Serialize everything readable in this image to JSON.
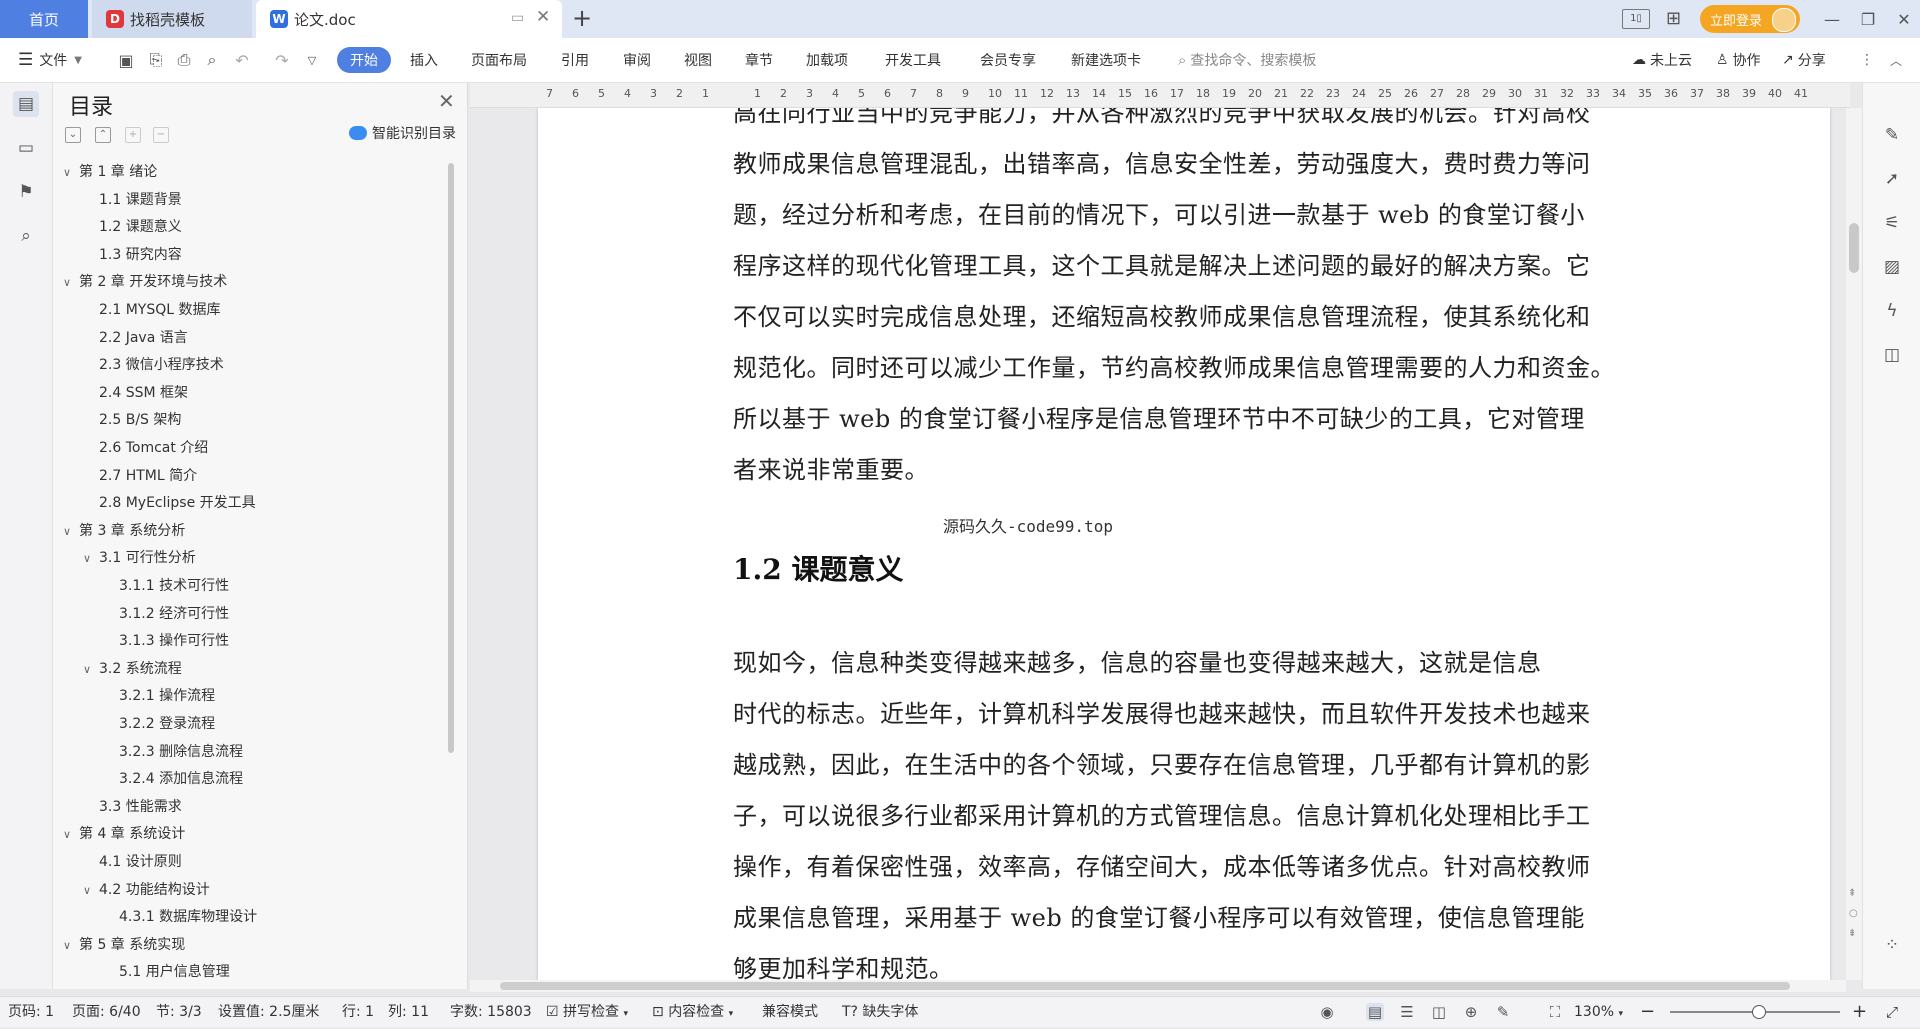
{
  "titlebar": {
    "tabs": [
      {
        "label": "首页"
      },
      {
        "label": "找稻壳模板"
      },
      {
        "label": "论文.doc"
      }
    ],
    "login_label": "立即登录"
  },
  "toolbar": {
    "file_label": "文件",
    "tabs": [
      "开始",
      "插入",
      "页面布局",
      "引用",
      "审阅",
      "视图",
      "章节",
      "加载项",
      "开发工具",
      "会员专享",
      "新建选项卡"
    ],
    "search_placeholder": "查找命令、搜索模板",
    "cloud_label": "未上云",
    "collab_label": "协作",
    "share_label": "分享"
  },
  "toc": {
    "title": "目录",
    "smart_label": "智能识别目录",
    "items": [
      {
        "label": "第 1 章  绪论",
        "level": 1,
        "caret": true
      },
      {
        "label": "1.1  课题背景",
        "level": 2
      },
      {
        "label": "1.2  课题意义",
        "level": 2
      },
      {
        "label": "1.3  研究内容",
        "level": 2
      },
      {
        "label": "第 2 章  开发环境与技术",
        "level": 1,
        "caret": true
      },
      {
        "label": "2.1  MYSQL 数据库",
        "level": 2
      },
      {
        "label": "2.2 Java 语言",
        "level": 2
      },
      {
        "label": "2.3  微信小程序技术",
        "level": 2
      },
      {
        "label": "2.4  SSM 框架",
        "level": 2
      },
      {
        "label": "2.5  B/S 架构",
        "level": 2
      },
      {
        "label": "2.6  Tomcat  介绍",
        "level": 2
      },
      {
        "label": "2.7  HTML 简介",
        "level": 2
      },
      {
        "label": "2.8  MyEclipse 开发工具",
        "level": 2
      },
      {
        "label": "第 3 章  系统分析",
        "level": 1,
        "caret": true
      },
      {
        "label": "3.1  可行性分析",
        "level": 2,
        "caret": true
      },
      {
        "label": "3.1.1  技术可行性",
        "level": 3
      },
      {
        "label": "3.1.2  经济可行性",
        "level": 3
      },
      {
        "label": "3.1.3  操作可行性",
        "level": 3
      },
      {
        "label": "3.2  系统流程",
        "level": 2,
        "caret": true
      },
      {
        "label": "3.2.1  操作流程",
        "level": 3
      },
      {
        "label": "3.2.2  登录流程",
        "level": 3
      },
      {
        "label": "3.2.3  删除信息流程",
        "level": 3
      },
      {
        "label": "3.2.4  添加信息流程",
        "level": 3
      },
      {
        "label": "3.3  性能需求",
        "level": 2
      },
      {
        "label": "第 4 章  系统设计",
        "level": 1,
        "caret": true
      },
      {
        "label": "4.1  设计原则",
        "level": 2
      },
      {
        "label": "4.2  功能结构设计",
        "level": 2,
        "caret": true
      },
      {
        "label": "4.3.1  数据库物理设计",
        "level": 3
      },
      {
        "label": "第 5 章  系统实现",
        "level": 1,
        "caret": true
      },
      {
        "label": "5.1 用户信息管理",
        "level": 3
      }
    ]
  },
  "ruler": {
    "ticks": [
      "7",
      "6",
      "5",
      "4",
      "3",
      "2",
      "1",
      "",
      "1",
      "2",
      "3",
      "4",
      "5",
      "6",
      "7",
      "8",
      "9",
      "10",
      "11",
      "12",
      "13",
      "14",
      "15",
      "16",
      "17",
      "18",
      "19",
      "20",
      "21",
      "22",
      "23",
      "24",
      "25",
      "26",
      "27",
      "28",
      "29",
      "30",
      "31",
      "32",
      "33",
      "34",
      "35",
      "36",
      "37",
      "38",
      "39",
      "40",
      "41"
    ]
  },
  "document": {
    "para1": [
      "高在同行业当中的竞争能力，并从各种激烈的竞争中获取发展的机会。针对高校",
      "教师成果信息管理混乱，出错率高，信息安全性差，劳动强度大，费时费力等问",
      "题，经过分析和考虑，在目前的情况下，可以引进一款基于 web 的食堂订餐小",
      "程序这样的现代化管理工具，这个工具就是解决上述问题的最好的解决方案。它",
      "不仅可以实时完成信息处理，还缩短高校教师成果信息管理流程，使其系统化和",
      "规范化。同时还可以减少工作量，节约高校教师成果信息管理需要的人力和资金。",
      "所以基于 web 的食堂订餐小程序是信息管理环节中不可缺少的工具，它对管理",
      "者来说非常重要。"
    ],
    "watermark": "源码久久-code99.top",
    "heading": "1.2  课题意义",
    "para2": [
      "    现如今，信息种类变得越来越多，信息的容量也变得越来越大，这就是信息",
      "时代的标志。近些年，计算机科学发展得也越来越快，而且软件开发技术也越来",
      "越成熟，因此，在生活中的各个领域，只要存在信息管理，几乎都有计算机的影",
      "子，可以说很多行业都采用计算机的方式管理信息。信息计算机化处理相比手工",
      "操作，有着保密性强，效率高，存储空间大，成本低等诸多优点。针对高校教师",
      "成果信息管理，采用基于 web 的食堂订餐小程序可以有效管理，使信息管理能",
      "够更加科学和规范。"
    ]
  },
  "status": {
    "page_num": "页码: 1",
    "page": "页面: 6/40",
    "section": "节: 3/3",
    "setting": "设置值: 2.5厘米",
    "row": "行: 1",
    "col": "列: 11",
    "words": "字数: 15803",
    "spell": "拼写检查",
    "content_check": "内容检查",
    "compat": "兼容模式",
    "missing_font": "缺失字体",
    "zoom": "130%"
  }
}
